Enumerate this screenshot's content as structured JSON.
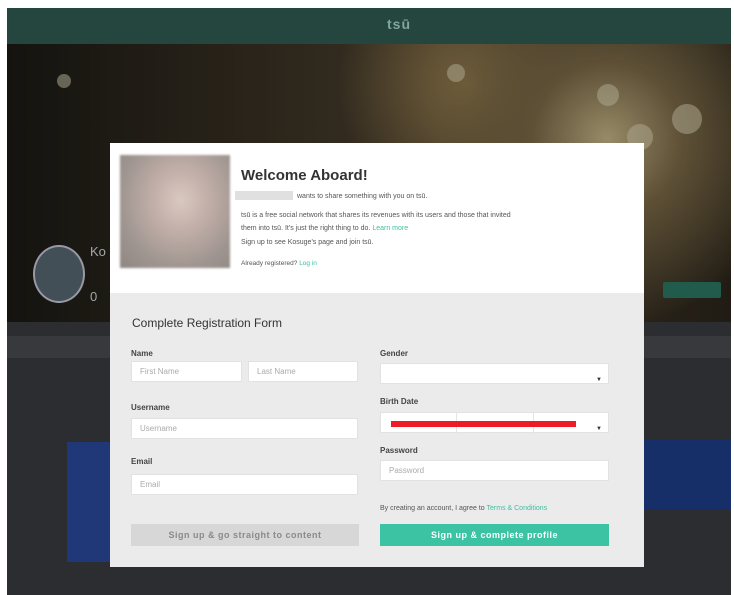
{
  "app": {
    "logo_text": "tsū"
  },
  "profile": {
    "name_partial": "Ko",
    "count_partial": "0"
  },
  "modal": {
    "title": "Welcome Aboard!",
    "share_text": "wants to share something with you on tsū.",
    "desc_line1": "tsū is a free social network that shares its revenues with its users and those that invited",
    "desc_line2": "them into tsū. It's just the right thing to do.",
    "learn_more": "Learn more",
    "signup_line": "Sign up to see Kosuge's page and join tsū.",
    "already": "Already registered?",
    "login": "Log in"
  },
  "form": {
    "title": "Complete Registration Form",
    "name_label": "Name",
    "first_name_placeholder": "First Name",
    "last_name_placeholder": "Last Name",
    "username_label": "Username",
    "username_placeholder": "Username",
    "email_label": "Email",
    "email_placeholder": "Email",
    "gender_label": "Gender",
    "gender_value": "",
    "birthdate_label": "Birth Date",
    "password_label": "Password",
    "password_placeholder": "Password",
    "terms_text": "By creating an account, I agree to",
    "terms_link": "Terms & Conditions",
    "btn_content": "Sign up & go straight to content",
    "btn_profile": "Sign up & complete profile"
  },
  "colors": {
    "topbar": "#24463f",
    "accent_green": "#3cc3a3",
    "link_green": "#3fbf9f",
    "redaction_red": "#ee1c25"
  }
}
